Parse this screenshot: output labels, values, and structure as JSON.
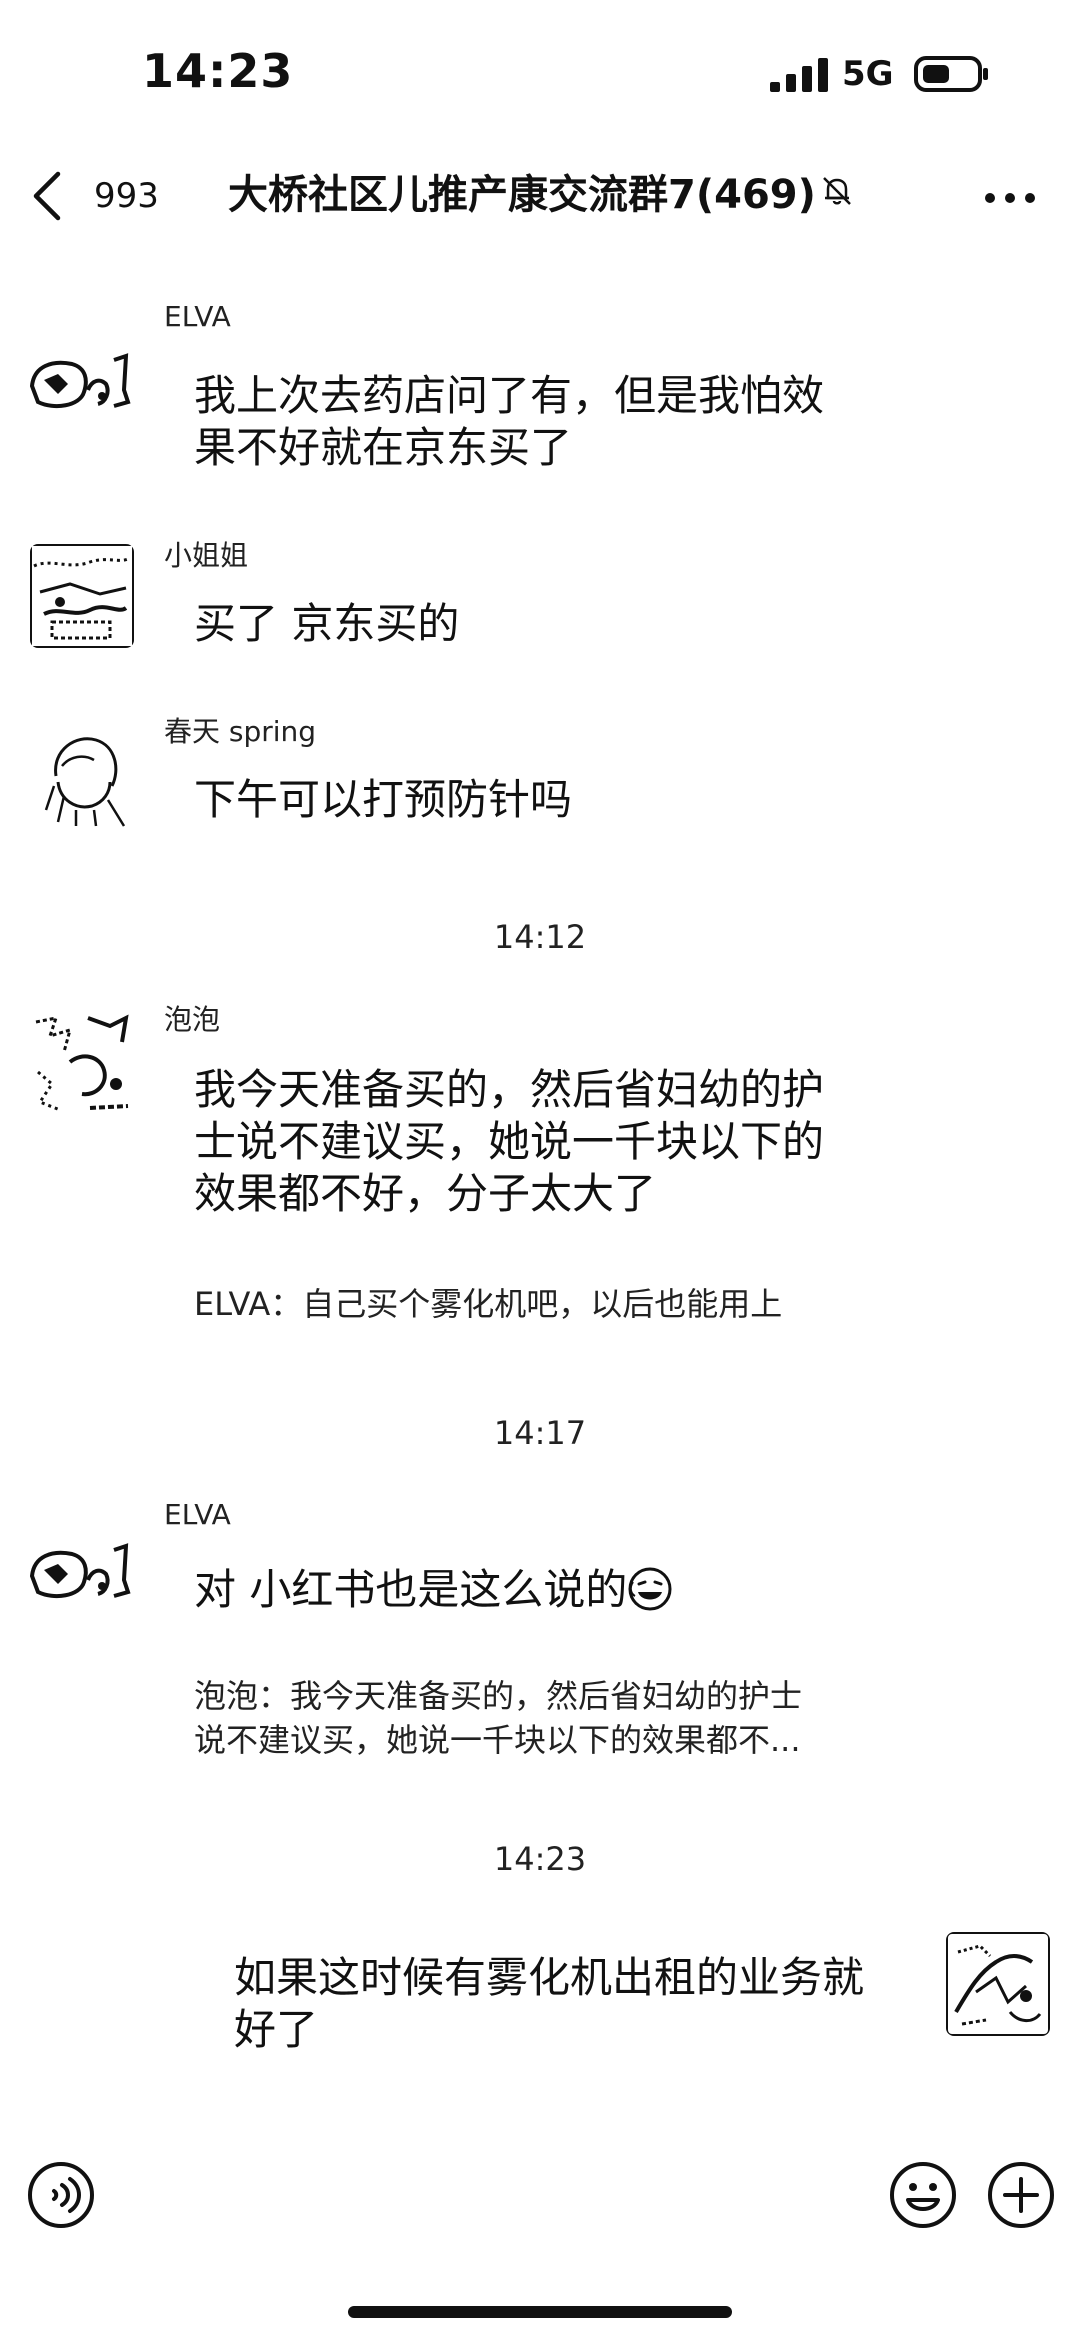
{
  "status_bar": {
    "time": "14:23",
    "network": "5G"
  },
  "nav": {
    "unread_count": "993",
    "title": "大桥社区儿推产康交流群7(469)"
  },
  "messages": [
    {
      "sender": "ELVA",
      "text_lines": [
        "我上次去药店问了有，但是我怕效",
        "果不好就在京东买了"
      ]
    },
    {
      "sender": "小姐姐",
      "text_lines": [
        "买了 京东买的"
      ]
    },
    {
      "sender": "春天 spring",
      "text_lines": [
        "下午可以打预防针吗"
      ]
    },
    {
      "sender": "泡泡",
      "text_lines": [
        "我今天准备买的，然后省妇幼的护",
        "士说不建议买，她说一千块以下的",
        "效果都不好，分子太大了"
      ],
      "quote": [
        "ELVA：自己买个雾化机吧，以后也能用上"
      ]
    },
    {
      "sender": "ELVA",
      "text_lines": [
        "对 小红书也是这么说的"
      ],
      "quote": [
        "泡泡：我今天准备买的，然后省妇幼的护士",
        "说不建议买，她说一千块以下的效果都不..."
      ]
    },
    {
      "sender": "",
      "text_lines": [
        "如果这时候有雾化机出租的业务就",
        "好了"
      ]
    }
  ],
  "timestamps": [
    "14:12",
    "14:17",
    "14:23"
  ],
  "icons": {
    "back": "chevron-left-icon",
    "mute": "bell-off-icon",
    "more": "more-dots-icon",
    "voice": "voice-icon",
    "emoji": "smile-icon",
    "plus": "plus-icon",
    "reaction": "laugh-emoji-icon"
  }
}
